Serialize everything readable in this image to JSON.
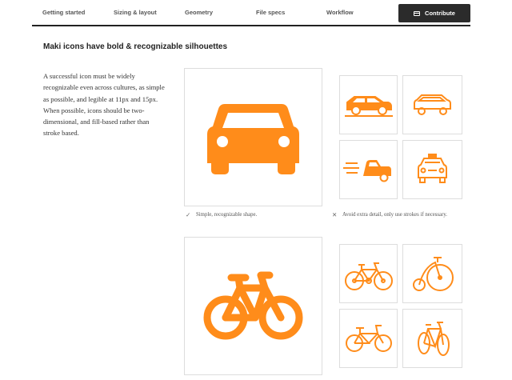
{
  "nav": {
    "items": [
      "Getting started",
      "Sizing & layout",
      "Geometry",
      "File specs",
      "Workflow"
    ],
    "contribute_label": "Contribute"
  },
  "section": {
    "heading": "Maki icons have bold & recognizable silhouettes",
    "body": "A successful icon must be widely recognizable even across cultures, as simple as possible, and legible at 11px and 15px. When possible, icons should be two-dimensional, and fill-based rather than stroke based."
  },
  "captions": {
    "do": "Simple, recognizable shape.",
    "dont": "Avoid extra detail, only use strokes if necessary."
  },
  "icons": {
    "good_1": "car-icon",
    "bad_1": [
      "suv-icon",
      "car-outline-icon",
      "speeding-car-icon",
      "taxi-icon"
    ],
    "good_2": "bicycle-icon",
    "bad_2": [
      "detailed-bicycle-icon",
      "penny-farthing-icon",
      "bmx-bicycle-icon",
      "road-bicycle-icon"
    ]
  },
  "colors": {
    "accent": "#ff8c1a",
    "nav_bar": "#2b2b2b"
  }
}
